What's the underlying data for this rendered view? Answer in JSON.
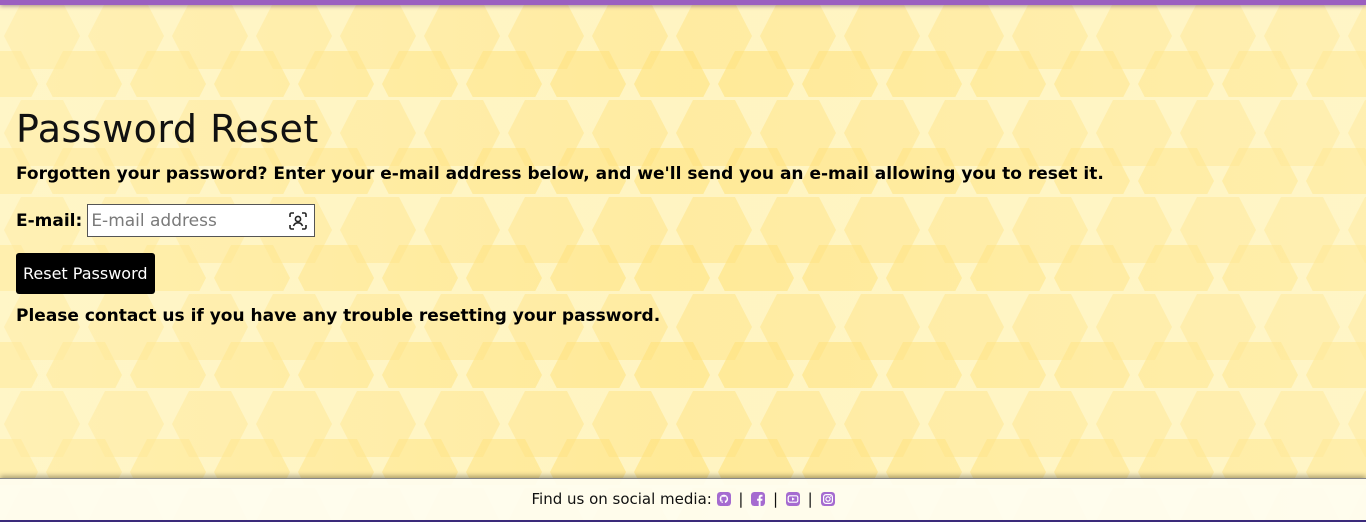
{
  "page": {
    "title": "Password Reset",
    "intro": "Forgotten your password? Enter your e-mail address below, and we'll send you an e-mail allowing you to reset it.",
    "help": "Please contact us if you have any trouble resetting your password."
  },
  "form": {
    "email_label": "E-mail:",
    "email_placeholder": "E-mail address",
    "email_value": "",
    "submit_label": "Reset Password"
  },
  "footer": {
    "text": "Find us on social media:",
    "separator": "|",
    "icons": [
      "github-icon",
      "facebook-icon",
      "youtube-icon",
      "instagram-icon"
    ]
  },
  "colors": {
    "accent": "#a56bd0",
    "top_bar": "#9b5fc0",
    "background": "#fff3b8",
    "honeycomb": "#ffe27a",
    "button": "#000000"
  }
}
